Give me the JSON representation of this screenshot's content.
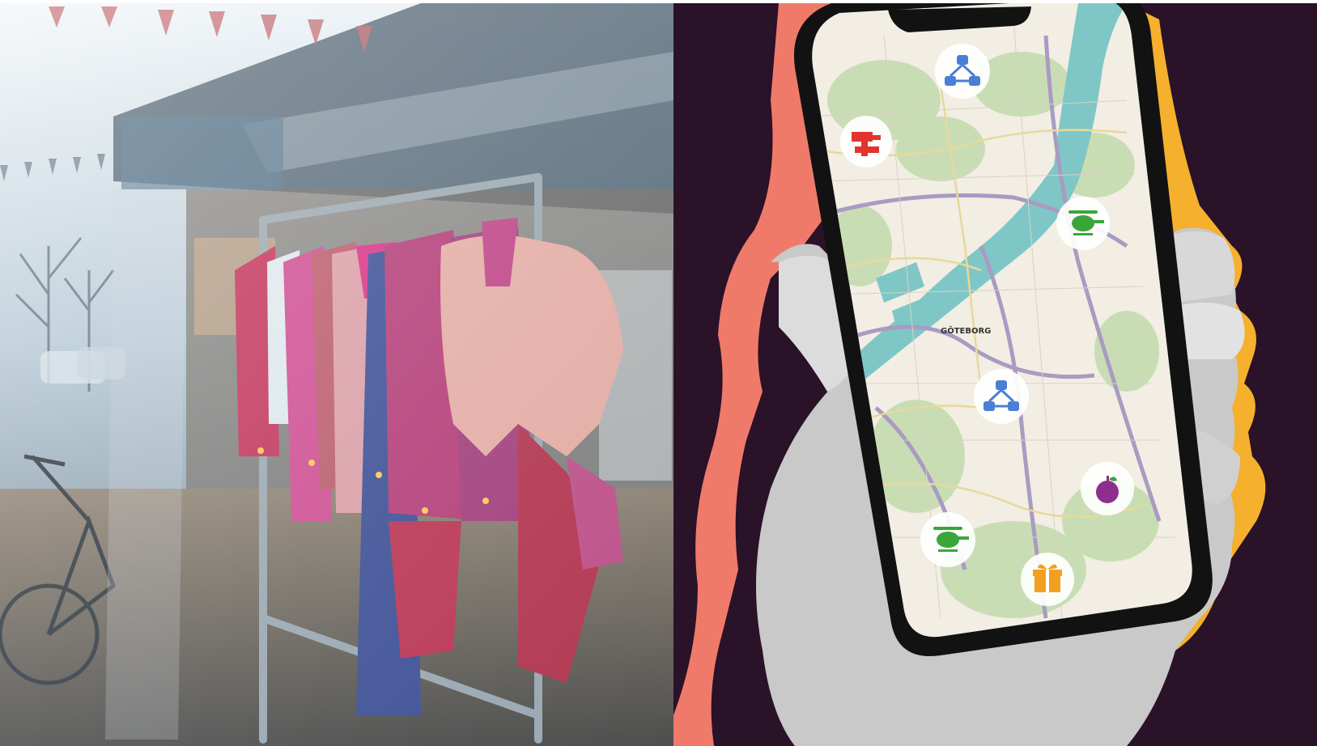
{
  "scene": {
    "left": {
      "subject": "clothing-rack-in-shop-window"
    },
    "right": {
      "subject": "hand-holding-smartphone-map",
      "background_color": "#2a1228",
      "accent_colors": [
        "#f07a6a",
        "#f5b02e"
      ]
    }
  },
  "map": {
    "city_label": "GÖTEBORG",
    "markers": [
      {
        "icon": "network-icon",
        "color": "#4a7fd6"
      },
      {
        "icon": "hammer-icon",
        "color": "#e2342f"
      },
      {
        "icon": "helicopter-icon",
        "color": "#3aa63a"
      },
      {
        "icon": "network-icon",
        "color": "#4a7fd6"
      },
      {
        "icon": "apple-icon",
        "color": "#8e2f8e"
      },
      {
        "icon": "helicopter-icon",
        "color": "#3aa63a"
      },
      {
        "icon": "gift-icon",
        "color": "#f2a020"
      }
    ]
  }
}
